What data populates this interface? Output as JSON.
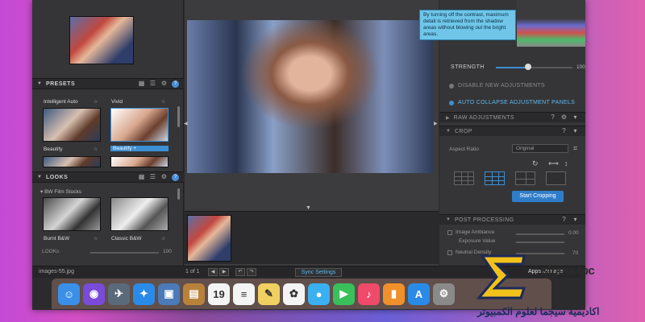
{
  "left_panel": {
    "presets_title": "PRESETS",
    "presets": [
      {
        "label": "Intelligent Auto",
        "selected": false
      },
      {
        "label": "Vivid",
        "selected": false
      },
      {
        "label": "Beautify",
        "selected": false
      },
      {
        "label": "Beautify +",
        "selected": true
      }
    ],
    "looks_title": "LOOKS",
    "looks_category": "BW Film Stocks",
    "looks": [
      {
        "label": "Burnt B&W"
      },
      {
        "label": "Classic B&W"
      }
    ],
    "looks_strength_label": "LOOKs",
    "looks_strength_value": "100"
  },
  "right_panel": {
    "tooltip": "By turning off the contrast, maximum detail is retrieved from the shadow areas without blowing out the bright areas.",
    "strength_label": "STRENGTH",
    "strength_value": "100",
    "strength_fraction": 0.42,
    "options": [
      {
        "label": "DISABLE NEW ADJUSTMENTS",
        "on": false
      },
      {
        "label": "AUTO COLLAPSE ADJUSTMENT PANELS",
        "on": true
      }
    ],
    "raw_adjustments": "RAW ADJUSTMENTS",
    "crop_title": "CROP",
    "aspect_ratio_label": "Aspect Ratio",
    "aspect_ratio_value": "Original",
    "start_cropping": "Start Cropping",
    "post_processing_title": "POST PROCESSING",
    "pp_rows": [
      {
        "label": "Image Ambiance",
        "value": "0.00"
      },
      {
        "label": "Exposure Value",
        "value": ""
      },
      {
        "label": "Neutral Density",
        "value": "70"
      }
    ]
  },
  "status_bar": {
    "image_name": "images-55.jpg",
    "page_info": "1 of 1",
    "sync_settings": "Sync Settings",
    "apps_manager": "Apps Manager"
  },
  "dock": {
    "icons": [
      {
        "name": "finder-icon",
        "color": "#3a8fe8",
        "glyph": "☺"
      },
      {
        "name": "siri-icon",
        "color": "#7a4ad8",
        "glyph": "◉"
      },
      {
        "name": "launchpad-icon",
        "color": "#5a6a7a",
        "glyph": "✈"
      },
      {
        "name": "safari-icon",
        "color": "#2a8ae8",
        "glyph": "✦"
      },
      {
        "name": "preview-icon",
        "color": "#4a7ab8",
        "glyph": "▣"
      },
      {
        "name": "notes-brown-icon",
        "color": "#b8823a",
        "glyph": "▤"
      },
      {
        "name": "calendar-icon",
        "color": "#f4f4f4",
        "glyph": "19"
      },
      {
        "name": "reminders-icon",
        "color": "#f4f4f4",
        "glyph": "≡"
      },
      {
        "name": "notes-icon",
        "color": "#f0d060",
        "glyph": "✎"
      },
      {
        "name": "photos-icon",
        "color": "#f4f4f4",
        "glyph": "✿"
      },
      {
        "name": "messages-icon",
        "color": "#3ab0f0",
        "glyph": "●"
      },
      {
        "name": "facetime-icon",
        "color": "#3ac05a",
        "glyph": "▶"
      },
      {
        "name": "music-icon",
        "color": "#f04a6a",
        "glyph": "♪"
      },
      {
        "name": "books-icon",
        "color": "#f0902a",
        "glyph": "▮"
      },
      {
        "name": "app-store-icon",
        "color": "#2a8ae8",
        "glyph": "A"
      },
      {
        "name": "system-preferences-icon",
        "color": "#8a8a8a",
        "glyph": "⚙"
      }
    ]
  },
  "watermark": {
    "brand": "sigma4pc",
    "arabic": "اكاديمية سيجما لعلوم الكمبيوتر"
  }
}
